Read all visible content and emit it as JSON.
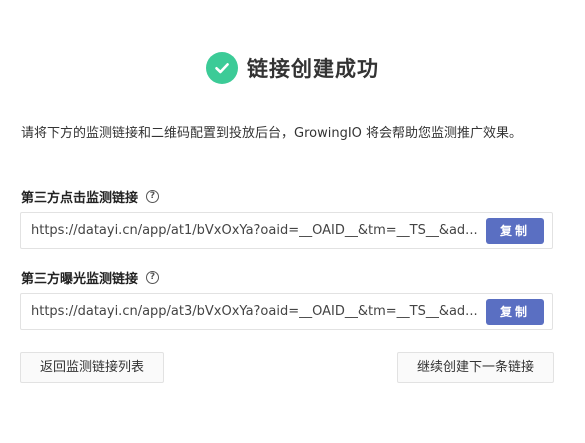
{
  "header": {
    "title": "链接创建成功",
    "icon": "check-circle-icon",
    "icon_color": "#3ccb97"
  },
  "description": "请将下方的监测链接和二维码配置到投放后台，GrowingIO 将会帮助您监测推广效果。",
  "click_link": {
    "label": "第三方点击监测链接",
    "help": "?",
    "url": "https://datayi.cn/app/at1/bVxOxYa?oaid=__OAID__&tm=__TS__&ad...",
    "copy_label": "复制"
  },
  "impression_link": {
    "label": "第三方曝光监测链接",
    "help": "?",
    "url": "https://datayi.cn/app/at3/bVxOxYa?oaid=__OAID__&tm=__TS__&ad...",
    "copy_label": "复制"
  },
  "footer": {
    "back_label": "返回监测链接列表",
    "next_label": "继续创建下一条链接"
  },
  "colors": {
    "accent": "#5a6fc2",
    "success": "#3ccb97"
  }
}
